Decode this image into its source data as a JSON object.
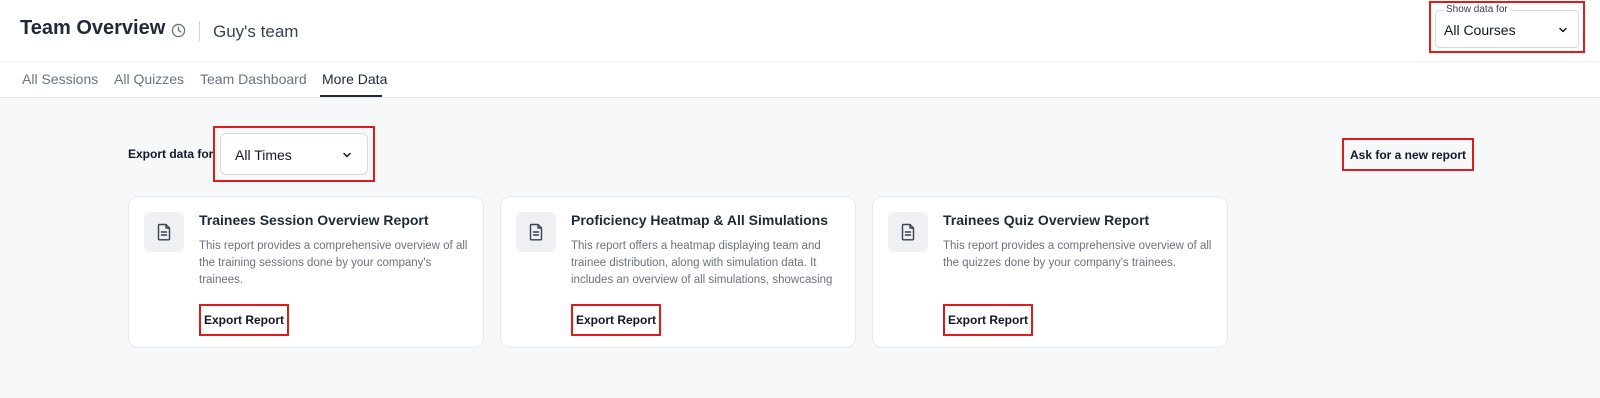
{
  "header": {
    "title": "Team Overview",
    "team_name": "Guy's team",
    "course_filter": {
      "label": "Show data for",
      "value": "All Courses"
    }
  },
  "tabs": [
    {
      "label": "All Sessions",
      "active": false
    },
    {
      "label": "All Quizzes",
      "active": false
    },
    {
      "label": "Team Dashboard",
      "active": false
    },
    {
      "label": "More Data",
      "active": true
    }
  ],
  "export": {
    "label": "Export data for",
    "time_value": "All Times",
    "ask_button": "Ask for a new report"
  },
  "reports": [
    {
      "title": "Trainees Session Overview Report",
      "description": "This report provides a comprehensive overview of all the training sessions done by your company's trainees.",
      "button": "Export Report"
    },
    {
      "title": "Proficiency Heatmap & All Simulations",
      "description": "This report offers a heatmap displaying team and trainee distribution, along with simulation data. It includes an overview of all simulations, showcasing",
      "button": "Export Report"
    },
    {
      "title": "Trainees Quiz Overview Report",
      "description": "This report provides a comprehensive overview of all the quizzes done by your company's trainees.",
      "button": "Export Report"
    }
  ],
  "colors": {
    "highlight": "#e01b1b",
    "text": "#1f2937",
    "muted": "#6b7280"
  }
}
